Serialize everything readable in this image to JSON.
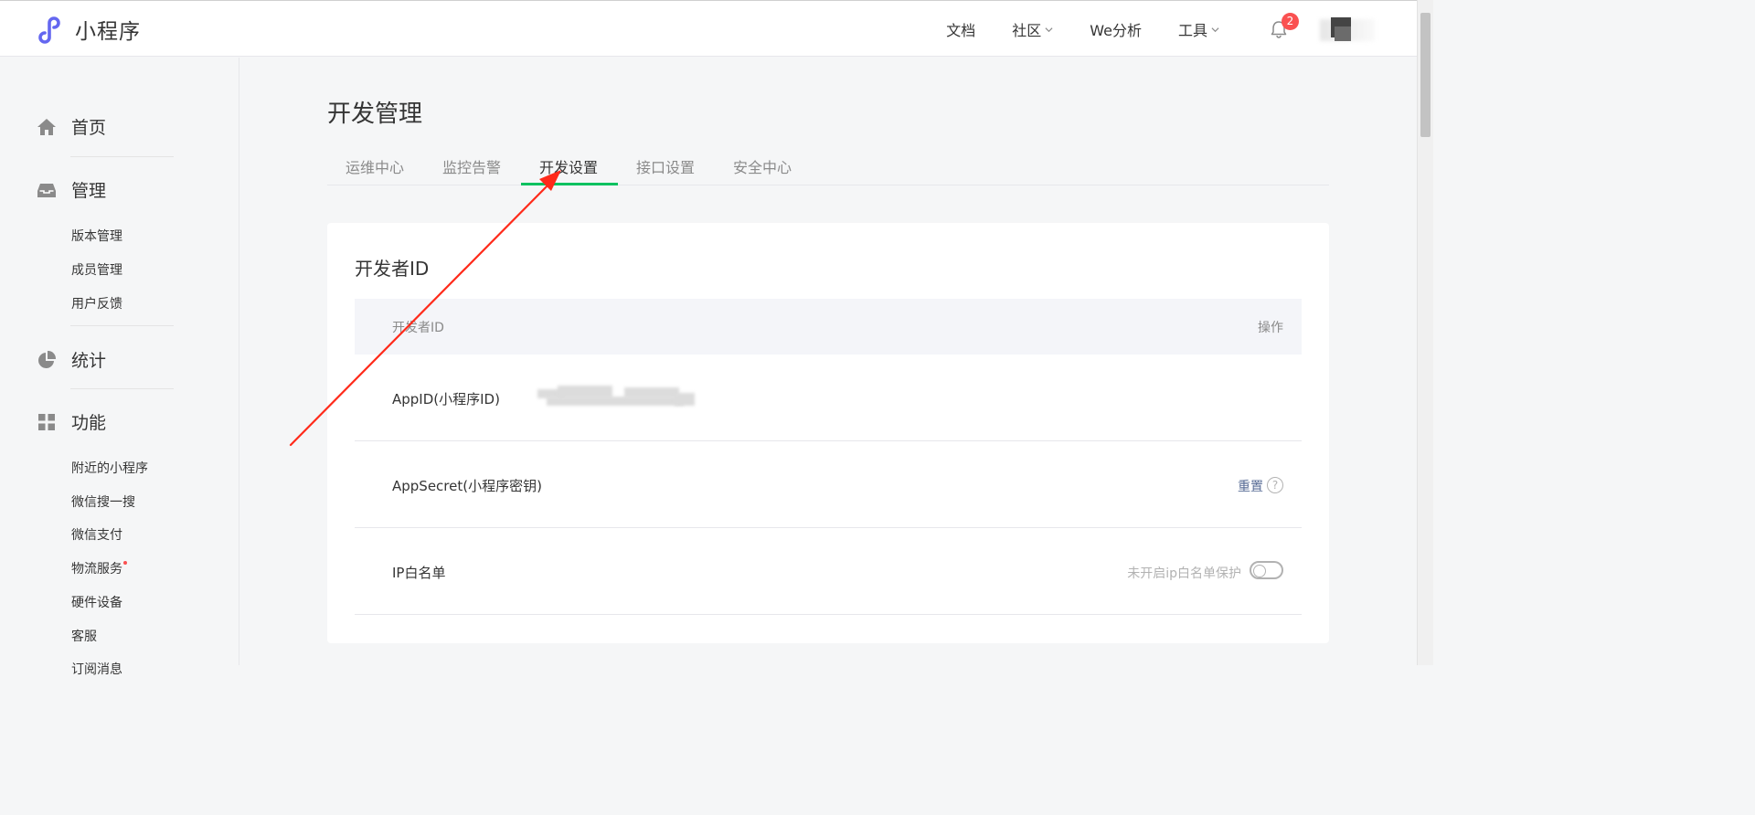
{
  "brand": {
    "name": "小程序"
  },
  "topnav": {
    "docs": "文档",
    "community": "社区",
    "analytics": "We分析",
    "tools": "工具",
    "notification_count": "2"
  },
  "sidebar": {
    "home": "首页",
    "manage": "管理",
    "manage_items": [
      "版本管理",
      "成员管理",
      "用户反馈"
    ],
    "stats": "统计",
    "features": "功能",
    "feature_items": [
      "附近的小程序",
      "微信搜一搜",
      "微信支付",
      "物流服务",
      "硬件设备",
      "客服",
      "订阅消息"
    ]
  },
  "page": {
    "title": "开发管理",
    "tabs": [
      "运维中心",
      "监控告警",
      "开发设置",
      "接口设置",
      "安全中心"
    ],
    "active_tab": "开发设置"
  },
  "developer_id": {
    "section_title": "开发者ID",
    "header_col": "开发者ID",
    "header_action": "操作",
    "appid_label": "AppID(小程序ID)",
    "appsecret_label": "AppSecret(小程序密钥)",
    "reset_link": "重置",
    "help_glyph": "?",
    "ip_label": "IP白名单",
    "ip_status": "未开启ip白名单保护",
    "ip_protection_enabled": false
  },
  "colors": {
    "accent_green": "#07c160",
    "link_blue": "#576b95",
    "badge_red": "#fa5151",
    "annotation_arrow": "#ff2a1a"
  },
  "icons": [
    "logo-icon",
    "chevron-down-icon",
    "bell-icon",
    "home-icon",
    "inbox-icon",
    "pie-chart-icon",
    "grid-icon",
    "help-icon"
  ]
}
